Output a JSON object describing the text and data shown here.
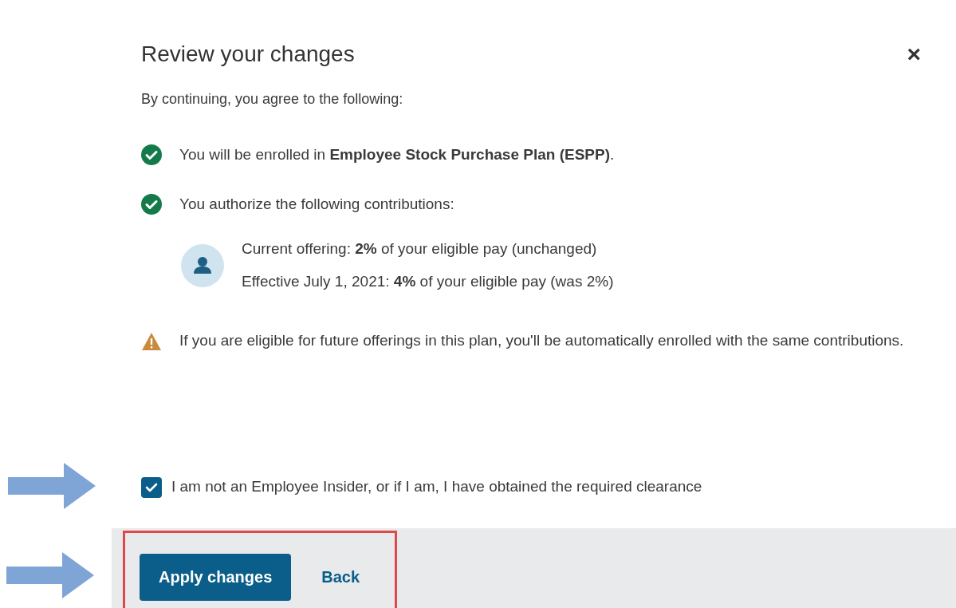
{
  "dialog": {
    "title": "Review your changes",
    "close_label": "×",
    "intro": "By continuing, you agree to the following:",
    "items": [
      {
        "kind": "check",
        "text": "You will be enrolled in **Employee Stock Purchase Plan (ESPP)**."
      },
      {
        "kind": "check",
        "text": "You authorize the following contributions:"
      }
    ],
    "contributions": [
      "Current offering: **2%** of your eligible pay (unchanged)",
      "Effective July 1, 2021: **4%** of your eligible pay (was 2%)"
    ],
    "warning": "If you are eligible for future offerings in this plan, you'll be automatically enrolled with the same contributions.",
    "agreement": {
      "label": "I am not an Employee Insider, or if I am, I have obtained the required clearance",
      "checked": true
    },
    "buttons": [
      {
        "kind": "primary",
        "label": "Apply changes"
      },
      {
        "kind": "link",
        "label": "Back"
      }
    ]
  }
}
